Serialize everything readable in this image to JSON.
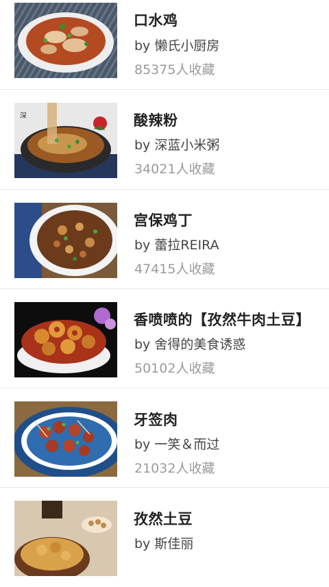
{
  "recipes": [
    {
      "title": "口水鸡",
      "author": "by 懒氏小厨房",
      "favorites": "85375人收藏",
      "image_icon": "dish-photo"
    },
    {
      "title": "酸辣粉",
      "author": "by 深蓝小米粥",
      "favorites": "34021人收藏",
      "image_icon": "dish-photo"
    },
    {
      "title": "宫保鸡丁",
      "author": "by 蕾拉REIRA",
      "favorites": "47415人收藏",
      "image_icon": "dish-photo"
    },
    {
      "title": "香喷喷的【孜然牛肉土豆】",
      "author": "by 舍得的美食诱惑",
      "favorites": "50102人收藏",
      "image_icon": "dish-photo"
    },
    {
      "title": "牙签肉",
      "author": "by 一笑＆而过",
      "favorites": "21032人收藏",
      "image_icon": "dish-photo"
    },
    {
      "title": "孜然土豆",
      "author": "by 斯佳丽",
      "favorites": "",
      "image_icon": "dish-photo"
    }
  ]
}
